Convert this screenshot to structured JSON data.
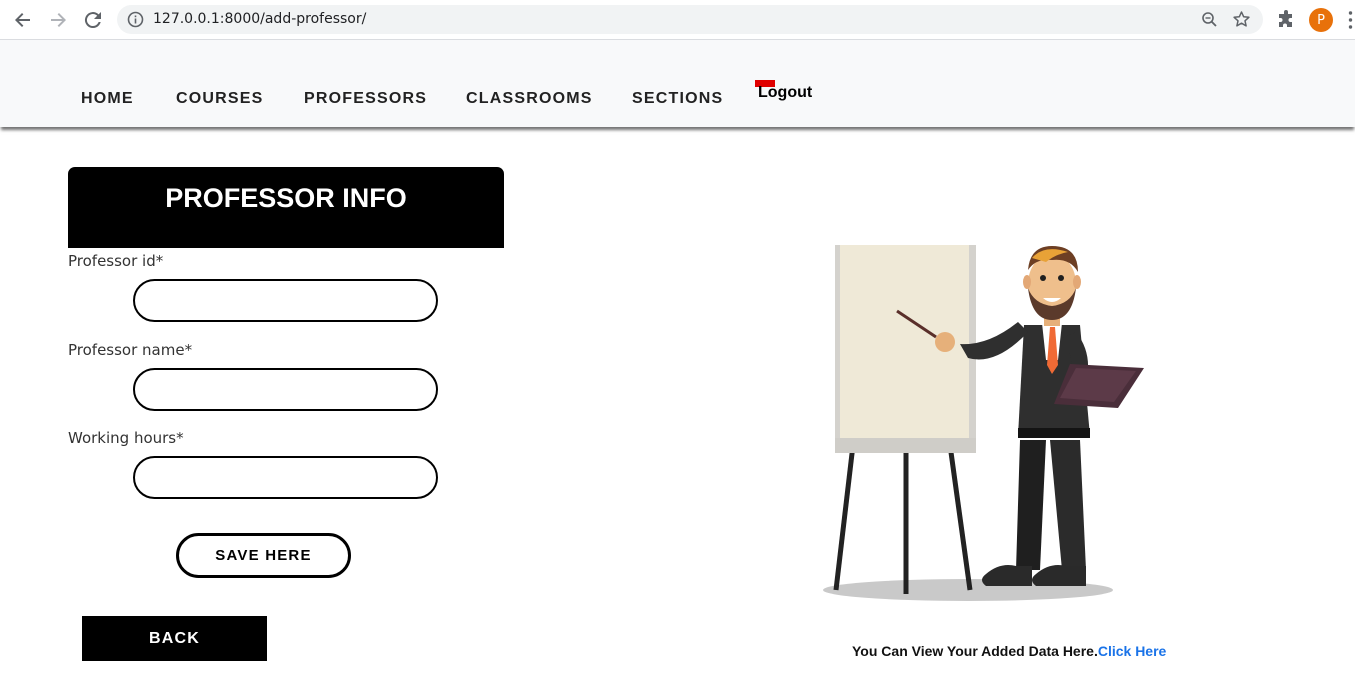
{
  "browser": {
    "url": "127.0.0.1:8000/add-professor/",
    "profile_initial": "P"
  },
  "navbar": {
    "items": [
      {
        "label": "HOME"
      },
      {
        "label": "COURSES"
      },
      {
        "label": "PROFESSORS"
      },
      {
        "label": "CLASSROOMS"
      },
      {
        "label": "SECTIONS"
      }
    ],
    "logout_label": "Logout"
  },
  "form": {
    "title": "PROFESSOR INFO",
    "fields": [
      {
        "label": "Professor id*",
        "value": ""
      },
      {
        "label": "Professor name*",
        "value": ""
      },
      {
        "label": "Working hours*",
        "value": ""
      }
    ],
    "save_label": "SAVE HERE",
    "back_label": "BACK"
  },
  "footer": {
    "text": "You Can View Your Added Data Here.",
    "link_label": "Click Here"
  },
  "colors": {
    "accent_link": "#1a73e8",
    "logout_marker": "#e00000",
    "avatar": "#e8710a",
    "tie": "#f06a35"
  }
}
